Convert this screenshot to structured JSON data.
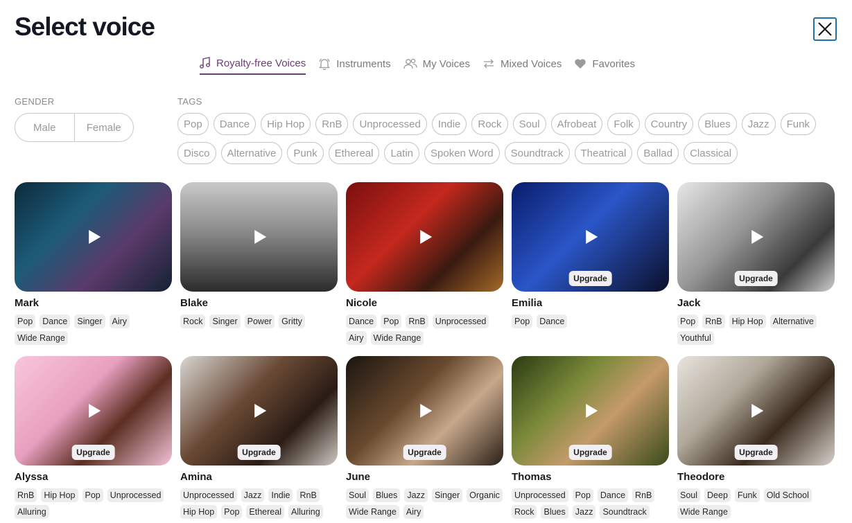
{
  "title": "Select voice",
  "tabs": [
    {
      "label": "Royalty-free Voices",
      "icon": "music-note-icon",
      "active": true
    },
    {
      "label": "Instruments",
      "icon": "bell-icon",
      "active": false
    },
    {
      "label": "My Voices",
      "icon": "users-icon",
      "active": false
    },
    {
      "label": "Mixed Voices",
      "icon": "swap-arrows-icon",
      "active": false
    },
    {
      "label": "Favorites",
      "icon": "heart-icon",
      "active": false
    }
  ],
  "filters": {
    "gender_label": "GENDER",
    "tags_label": "TAGS",
    "gender_options": [
      "Male",
      "Female"
    ],
    "tag_rows": [
      [
        "Pop",
        "Dance",
        "Hip Hop",
        "RnB",
        "Unprocessed",
        "Indie",
        "Rock",
        "Soul",
        "Afrobeat",
        "Folk",
        "Country",
        "Blues",
        "Jazz",
        "Funk"
      ],
      [
        "Disco",
        "Alternative",
        "Punk",
        "Ethereal",
        "Latin",
        "Spoken Word",
        "Soundtrack",
        "Theatrical",
        "Ballad",
        "Classical"
      ]
    ]
  },
  "upgrade_label": "Upgrade",
  "voices": [
    {
      "name": "Mark",
      "tags": [
        "Pop",
        "Dance",
        "Singer",
        "Airy",
        "Wide Range"
      ],
      "upgrade": false,
      "bg": "linear-gradient(135deg,#0d2a3c 0%,#1c5b78 35%,#5a3a6a 65%,#132233 100%)"
    },
    {
      "name": "Blake",
      "tags": [
        "Rock",
        "Singer",
        "Power",
        "Gritty"
      ],
      "upgrade": false,
      "bg": "linear-gradient(180deg,#c9c9c9 0%,#8a8a8a 45%,#2b2b2b 100%)"
    },
    {
      "name": "Nicole",
      "tags": [
        "Dance",
        "Pop",
        "RnB",
        "Unprocessed",
        "Airy",
        "Wide Range"
      ],
      "upgrade": false,
      "bg": "linear-gradient(135deg,#7a0f0f 0%,#c4281e 40%,#3a1a10 70%,#a36a2a 100%)"
    },
    {
      "name": "Emilia",
      "tags": [
        "Pop",
        "Dance"
      ],
      "upgrade": true,
      "bg": "linear-gradient(135deg,#0a1c6a 0%,#2a56c8 45%,#0a0f2a 100%)"
    },
    {
      "name": "Jack",
      "tags": [
        "Pop",
        "RnB",
        "Hip Hop",
        "Alternative",
        "Youthful"
      ],
      "upgrade": true,
      "bg": "linear-gradient(135deg,#e6e6e6 0%,#9a9a9a 40%,#3a3a3a 75%,#cfcfcf 100%)"
    },
    {
      "name": "Alyssa",
      "tags": [
        "RnB",
        "Hip Hop",
        "Pop",
        "Unprocessed",
        "Alluring"
      ],
      "upgrade": true,
      "bg": "linear-gradient(135deg,#f7c6dc 0%,#e9a0c0 40%,#5a2e20 65%,#f4c2d8 100%)"
    },
    {
      "name": "Amina",
      "tags": [
        "Unprocessed",
        "Jazz",
        "Indie",
        "RnB",
        "Hip Hop",
        "Pop",
        "Ethereal",
        "Alluring"
      ],
      "upgrade": true,
      "bg": "linear-gradient(135deg,#d8d6d2 0%,#6a4a36 40%,#2a1c14 70%,#cfc9c2 100%)"
    },
    {
      "name": "June",
      "tags": [
        "Soul",
        "Blues",
        "Jazz",
        "Singer",
        "Organic",
        "Wide Range",
        "Airy"
      ],
      "upgrade": true,
      "bg": "linear-gradient(135deg,#1a1510 0%,#6a4a2e 40%,#c8a88a 65%,#2a2018 100%)"
    },
    {
      "name": "Thomas",
      "tags": [
        "Unprocessed",
        "Pop",
        "Dance",
        "RnB",
        "Rock",
        "Blues",
        "Jazz",
        "Soundtrack"
      ],
      "upgrade": true,
      "bg": "linear-gradient(135deg,#2a3a12 0%,#7a8a3a 35%,#c49a6a 60%,#3a4a1a 100%)"
    },
    {
      "name": "Theodore",
      "tags": [
        "Soul",
        "Deep",
        "Funk",
        "Old School",
        "Wide Range"
      ],
      "upgrade": true,
      "bg": "linear-gradient(135deg,#e8e4de 0%,#b0a89a 35%,#3a2a1e 65%,#d8d2ca 100%)"
    }
  ]
}
